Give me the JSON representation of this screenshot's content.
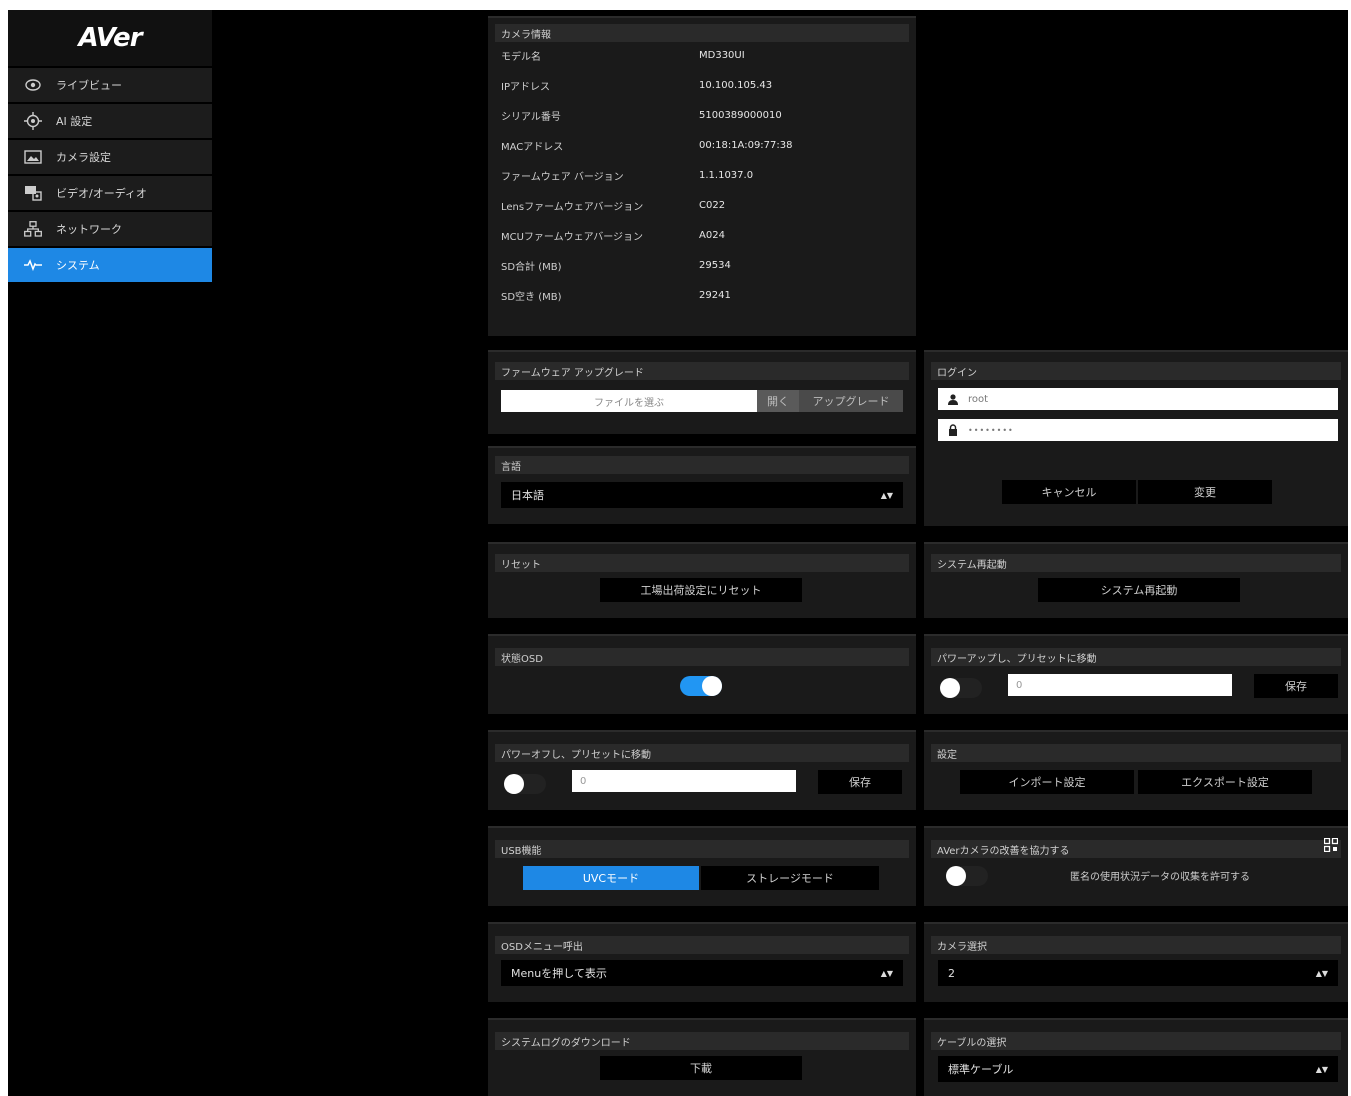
{
  "brand": {
    "logo": "AVer"
  },
  "sidebar": {
    "items": [
      {
        "label": "ライブビュー",
        "icon": "eye-icon"
      },
      {
        "label": "AI 設定",
        "icon": "crosshair-icon"
      },
      {
        "label": "カメラ設定",
        "icon": "image-icon"
      },
      {
        "label": "ビデオ/オーディオ",
        "icon": "video-audio-icon"
      },
      {
        "label": "ネットワーク",
        "icon": "network-icon"
      },
      {
        "label": "システム",
        "icon": "pulse-icon"
      }
    ],
    "active_index": 5
  },
  "camera_info": {
    "title": "カメラ情報",
    "rows": [
      {
        "label": "モデル名",
        "value": "MD330UI"
      },
      {
        "label": "IPアドレス",
        "value": "10.100.105.43"
      },
      {
        "label": "シリアル番号",
        "value": "5100389000010"
      },
      {
        "label": "MACアドレス",
        "value": "00:18:1A:09:77:38"
      },
      {
        "label": "ファームウェア バージョン",
        "value": "1.1.1037.0"
      },
      {
        "label": "Lensファームウェアバージョン",
        "value": "C022"
      },
      {
        "label": "MCUファームウェアバージョン",
        "value": "A024"
      },
      {
        "label": "SD合計 (MB)",
        "value": "29534"
      },
      {
        "label": "SD空き (MB)",
        "value": "29241"
      }
    ]
  },
  "firmware": {
    "title": "ファームウェア アップグレード",
    "file_placeholder": "ファイルを選ぶ",
    "open_label": "開く",
    "upgrade_label": "アップグレード"
  },
  "login": {
    "title": "ログイン",
    "username": "root",
    "password": "••••••••",
    "cancel_label": "キャンセル",
    "confirm_label": "変更"
  },
  "language": {
    "title": "言語",
    "selected": "日本語"
  },
  "reset": {
    "title": "リセット",
    "button": "工場出荷設定にリセット"
  },
  "reboot": {
    "title": "システム再起動",
    "button": "システム再起動"
  },
  "status_osd": {
    "title": "状態OSD",
    "on": true
  },
  "power_up_preset": {
    "title": "パワーアップし、プリセットに移動",
    "value": "0",
    "save_label": "保存",
    "on": false
  },
  "power_off_preset": {
    "title": "パワーオフし、プリセットに移動",
    "value": "0",
    "save_label": "保存",
    "on": false
  },
  "settings": {
    "title": "設定",
    "import_label": "インポート設定",
    "export_label": "エクスポート設定"
  },
  "usb": {
    "title": "USB機能",
    "uvc_label": "UVCモード",
    "storage_label": "ストレージモード",
    "selected": "uvc"
  },
  "improve": {
    "title": "AVerカメラの改善を協力する",
    "description": "匿名の使用状況データの収集を許可する",
    "on": false,
    "icon": "qr-icon"
  },
  "osd_menu": {
    "title": "OSDメニュー呼出",
    "selected": "Menuを押して表示"
  },
  "camera_select": {
    "title": "カメラ選択",
    "selected": "2"
  },
  "syslog": {
    "title": "システムログのダウンロード",
    "button": "下載"
  },
  "cable": {
    "title": "ケーブルの選択",
    "selected": "標準ケーブル"
  },
  "colors": {
    "accent": "#1e88e5",
    "panel": "#1a1a1a",
    "header": "#2a2a2a"
  }
}
